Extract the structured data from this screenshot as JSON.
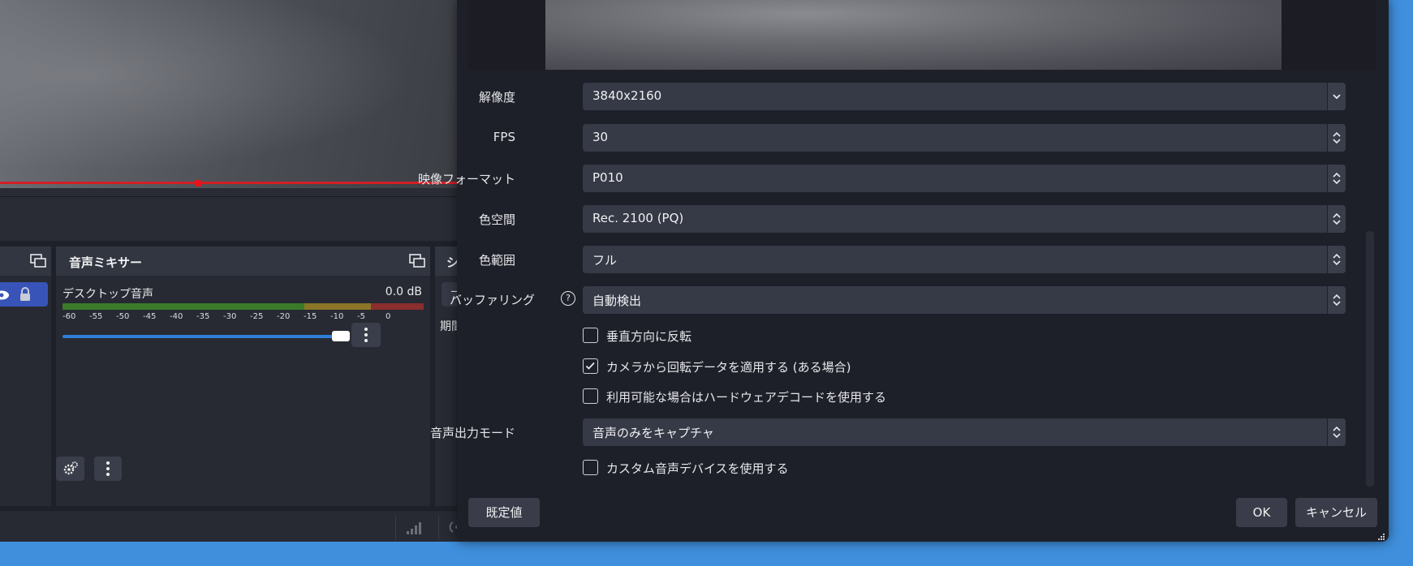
{
  "mixer": {
    "title": "音声ミキサー",
    "track": {
      "name": "デスクトップ音声",
      "level": "0.0 dB",
      "volume_fraction": 0.99,
      "ticks": [
        "-60",
        "-55",
        "-50",
        "-45",
        "-40",
        "-35",
        "-30",
        "-25",
        "-20",
        "-15",
        "-10",
        "-5",
        "0"
      ]
    }
  },
  "transitions": {
    "title_partial": "シ",
    "item_partial": "フ",
    "label_partial": "期間"
  },
  "dialog": {
    "fields": [
      {
        "label": "解像度",
        "value": "3840x2160",
        "control": "dropdown"
      },
      {
        "label": "FPS",
        "value": "30",
        "control": "spinner"
      },
      {
        "label": "映像フォーマット",
        "value": "P010",
        "control": "spinner"
      },
      {
        "label": "色空間",
        "value": "Rec. 2100 (PQ)",
        "control": "spinner"
      },
      {
        "label": "色範囲",
        "value": "フル",
        "control": "spinner"
      },
      {
        "label": "バッファリング",
        "value": "自動検出",
        "control": "spinner",
        "help": "?"
      }
    ],
    "checkboxes": [
      {
        "label": "垂直方向に反転",
        "checked": false
      },
      {
        "label": "カメラから回転データを適用する (ある場合)",
        "checked": true
      },
      {
        "label": "利用可能な場合はハードウェアデコードを使用する",
        "checked": false
      }
    ],
    "audio_mode": {
      "label": "音声出力モード",
      "value": "音声のみをキャプチャ"
    },
    "custom_audio": {
      "label": "カスタム音声デバイスを使用する",
      "checked": false
    },
    "buttons": {
      "defaults": "既定値",
      "ok": "OK",
      "cancel": "キャンセル"
    }
  },
  "colors": {
    "background": "#3f8fdc",
    "accent_blue": "#2f7fd8",
    "preview_border": "#d21f24",
    "panel": "#272a33",
    "dialog": "#1e2029"
  }
}
